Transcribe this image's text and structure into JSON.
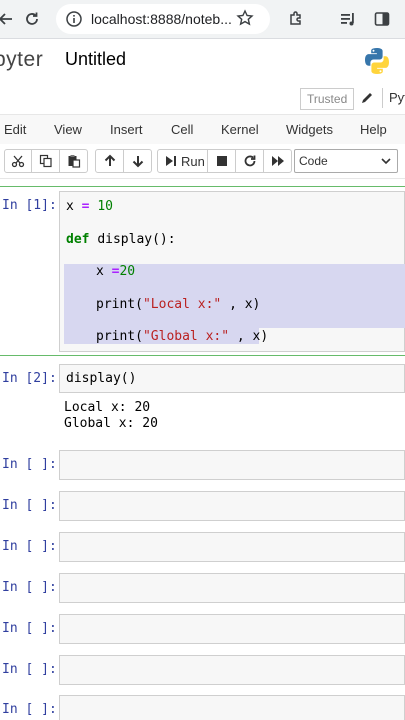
{
  "browser": {
    "url": "localhost:8888/noteb...",
    "icons": [
      "reload-icon",
      "info-icon",
      "star-icon",
      "extensions-icon",
      "media-icon",
      "sidebar-icon"
    ]
  },
  "header": {
    "logo_text": "pyter",
    "notebook_title": "Untitled",
    "trusted_label": "Trusted",
    "kernel_label": "Pyt"
  },
  "menu": {
    "items": [
      "Edit",
      "View",
      "Insert",
      "Cell",
      "Kernel",
      "Widgets",
      "Help"
    ]
  },
  "toolbar": {
    "run_label": "Run",
    "cell_type": "Code"
  },
  "cells": [
    {
      "prompt": "In [1]:",
      "lines": {
        "l1_var": "x",
        "l1_eq": "=",
        "l1_val": "10",
        "l2_kw": "def",
        "l2_name": "display():",
        "l3_code": "x ",
        "l3_eq": "=",
        "l3_val": "20",
        "l4_fn": "print(",
        "l4_str": "\"Local x:\"",
        "l4_rest": " , x)",
        "l5_fn": "print(",
        "l5_str": "\"Global x:\"",
        "l5_rest": " , x)"
      }
    },
    {
      "prompt": "In [2]:",
      "code": "display()",
      "output_1": "Local x: 20",
      "output_2": "Global x: 20"
    }
  ],
  "empty_prompts": [
    "In [ ]:",
    "In [ ]:",
    "In [ ]:",
    "In [ ]:",
    "In [ ]:",
    "In [ ]:",
    "In [ ]:"
  ],
  "colors": {
    "prompt": "#303f9f",
    "keyword": "#008000",
    "string": "#ba2121",
    "selection": "#d7d7f0",
    "selected_border": "#66bb6a"
  }
}
